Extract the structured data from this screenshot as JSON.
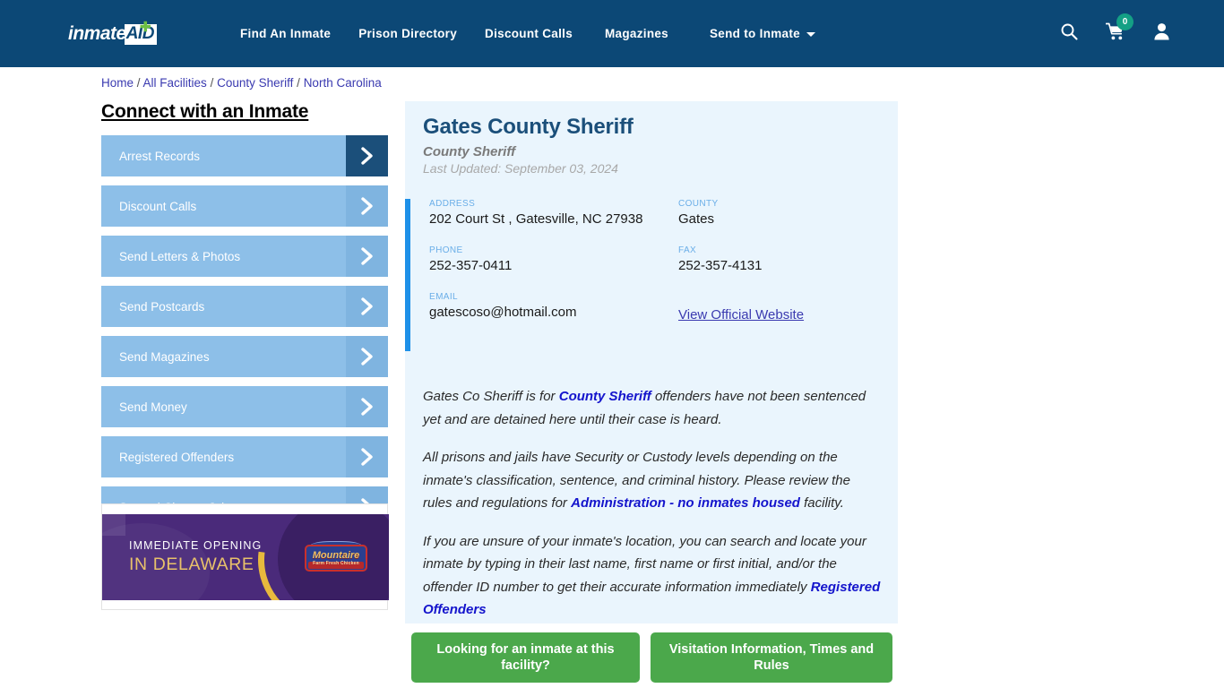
{
  "header": {
    "logo": {
      "word": "inmate",
      "badge": "AID",
      "cross_icon": "plus-icon"
    },
    "nav": [
      {
        "label": "Find An Inmate"
      },
      {
        "label": "Prison Directory"
      },
      {
        "label": "Discount Calls"
      },
      {
        "label": "Magazines"
      }
    ],
    "dropdown": {
      "label": "Send to Inmate"
    },
    "icons": {
      "search": "search-icon",
      "cart": "cart-icon",
      "cart_count": "0",
      "account": "user-icon"
    },
    "bg_color": "#0c4876",
    "badge_color": "#14a085"
  },
  "breadcrumb": {
    "items": [
      "Home",
      "All Facilities",
      "County Sheriff",
      "North Carolina"
    ],
    "separator": "/"
  },
  "sidebar": {
    "title": "Connect with an Inmate",
    "items": [
      {
        "label": "Arrest Records",
        "active": true
      },
      {
        "label": "Discount Calls",
        "active": false
      },
      {
        "label": "Send Letters & Photos",
        "active": false
      },
      {
        "label": "Send Postcards",
        "active": false
      },
      {
        "label": "Send Magazines",
        "active": false
      },
      {
        "label": "Send Money",
        "active": false
      },
      {
        "label": "Registered Offenders",
        "active": false
      },
      {
        "label": "Second Chance Jobs",
        "active": false
      }
    ],
    "ad": {
      "line1": "IMMEDIATE OPENING",
      "line2": "IN DELAWARE",
      "brand": "Mountaire",
      "brand_tagline": "Farm Fresh Chicken"
    }
  },
  "facility": {
    "name": "Gates County Sheriff",
    "type": "County Sheriff",
    "updated": "Last Updated: September 03, 2024",
    "fields": {
      "address_label": "ADDRESS",
      "address_value": "202 Court St , Gatesville, NC 27938",
      "county_label": "COUNTY",
      "county_value": "Gates",
      "phone_label": "PHONE",
      "phone_value": "252-357-0411",
      "fax_label": "FAX",
      "fax_value": "252-357-4131",
      "email_label": "EMAIL",
      "email_value": "gatescoso@hotmail.com",
      "website_link": "View Official Website"
    },
    "accent_color": "#1e90e8",
    "panel_bg": "#eaf5fd"
  },
  "description": {
    "p1_a": "Gates Co Sheriff is for ",
    "p1_link": "County Sheriff",
    "p1_b": " offenders have not been sentenced yet and are detained here until their case is heard.",
    "p2_a": "All prisons and jails have Security or Custody levels depending on the inmate's classification, sentence, and criminal history. Please review the rules and regulations for ",
    "p2_link": "Administration - no inmates housed",
    "p2_b": " facility.",
    "p3_a": "If you are unsure of your inmate's location, you can search and locate your inmate by typing in their last name, first name or first initial, and/or the offender ID number to get their accurate information immediately ",
    "p3_link": "Registered Offenders"
  },
  "cta": {
    "primary": "Looking for an inmate at this facility?",
    "secondary": "Visitation Information, Times and Rules",
    "color": "#4ba84b"
  }
}
